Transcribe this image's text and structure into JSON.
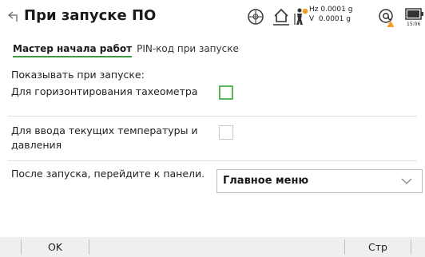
{
  "header": {
    "title": "При запуске ПО",
    "back_icon": "back-arrow-icon",
    "hz_label": "Hz 0.0001 g",
    "v_label": "V  0.0001 g",
    "battery_time": "15:06",
    "status_icons": [
      "crosshair-target-icon",
      "home-level-icon",
      "prism-person-icon",
      "at-warning-icon",
      "battery-icon"
    ]
  },
  "tabs": [
    {
      "label": "Мастер начала работ",
      "active": true
    },
    {
      "label": "PIN-код при запуске",
      "active": false
    }
  ],
  "section_label": "Показывать при запуске:",
  "options": [
    {
      "label": "Для горизонтирования тахеометра",
      "checked": false,
      "focused": true
    },
    {
      "label": "Для ввода текущих температуры и давления",
      "checked": false,
      "focused": false
    }
  ],
  "after_launch": {
    "label": "После запуска, перейдите к панели.",
    "value": "Главное меню"
  },
  "softkeys": {
    "ok": "OK",
    "page": "Стр"
  },
  "colors": {
    "accent_green": "#5cb85c",
    "tab_underline": "#3b9a3b",
    "warning_orange": "#f0a020"
  }
}
